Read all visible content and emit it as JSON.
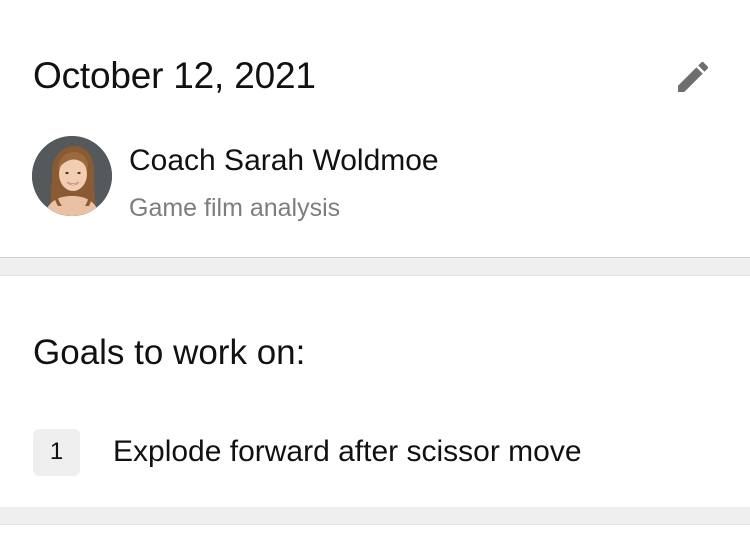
{
  "session": {
    "date": "October 12, 2021",
    "coach_name": "Coach Sarah Woldmoe",
    "subtitle": "Game film analysis",
    "edit_icon": "pencil-icon"
  },
  "goals": {
    "heading": "Goals to work on:",
    "items": [
      {
        "number": "1",
        "text": "Explode forward after scissor move"
      }
    ]
  },
  "colors": {
    "background": "#efefef",
    "card": "#ffffff",
    "primary_text": "#111111",
    "secondary_text": "#7d7d7d",
    "icon": "#6e6e6e"
  }
}
